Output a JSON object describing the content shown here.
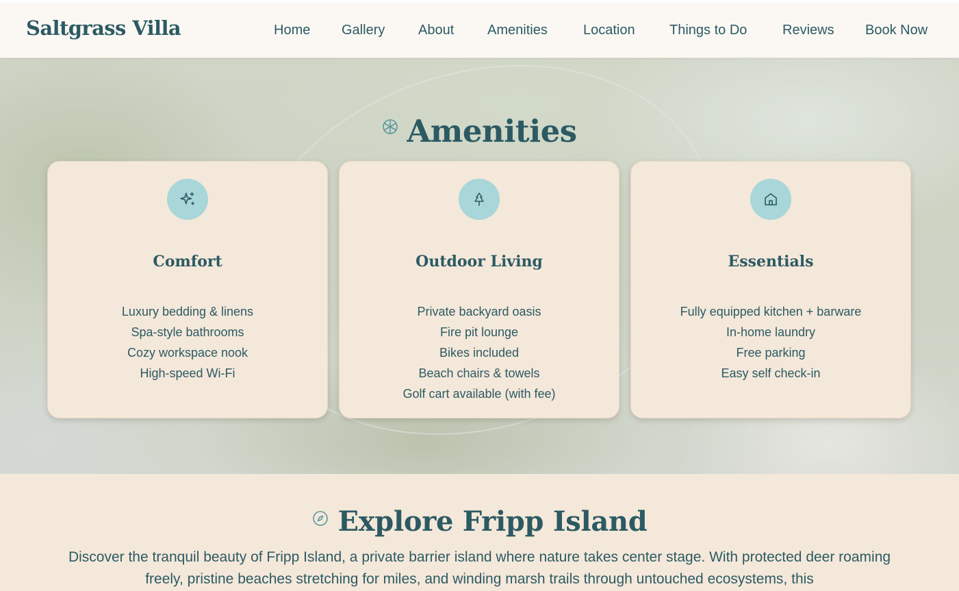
{
  "site": {
    "brand": "Saltgrass Villa"
  },
  "nav": {
    "items": [
      "Home",
      "Gallery",
      "About",
      "Amenities",
      "Location",
      "Things to Do",
      "Reviews",
      "Book Now"
    ]
  },
  "amenities": {
    "title": "Amenities",
    "title_icon": "snowflake-icon",
    "cards": [
      {
        "icon": "sparkles-icon",
        "title": "Comfort",
        "items": [
          "Luxury bedding & linens",
          "Spa-style bathrooms",
          "Cozy workspace nook",
          "High-speed Wi-Fi"
        ]
      },
      {
        "icon": "tree-icon",
        "title": "Outdoor Living",
        "items": [
          "Private backyard oasis",
          "Fire pit lounge",
          "Bikes included",
          "Beach chairs & towels",
          "Golf cart available (with fee)"
        ]
      },
      {
        "icon": "home-icon",
        "title": "Essentials",
        "items": [
          "Fully equipped kitchen + barware",
          "In-home laundry",
          "Free parking",
          "Easy self check-in"
        ]
      }
    ]
  },
  "explore": {
    "title": "Explore Fripp Island",
    "title_icon": "compass-icon",
    "text": "Discover the tranquil beauty of Fripp Island, a private barrier island where nature takes center stage. With protected deer roaming freely, pristine beaches stretching for miles, and winding marsh trails through untouched ecosystems, this"
  },
  "colors": {
    "primary": "#2c5a63",
    "background": "#f4e8da",
    "icon_circle": "#a8d6d9",
    "header_bg": "#fbf8f4"
  }
}
